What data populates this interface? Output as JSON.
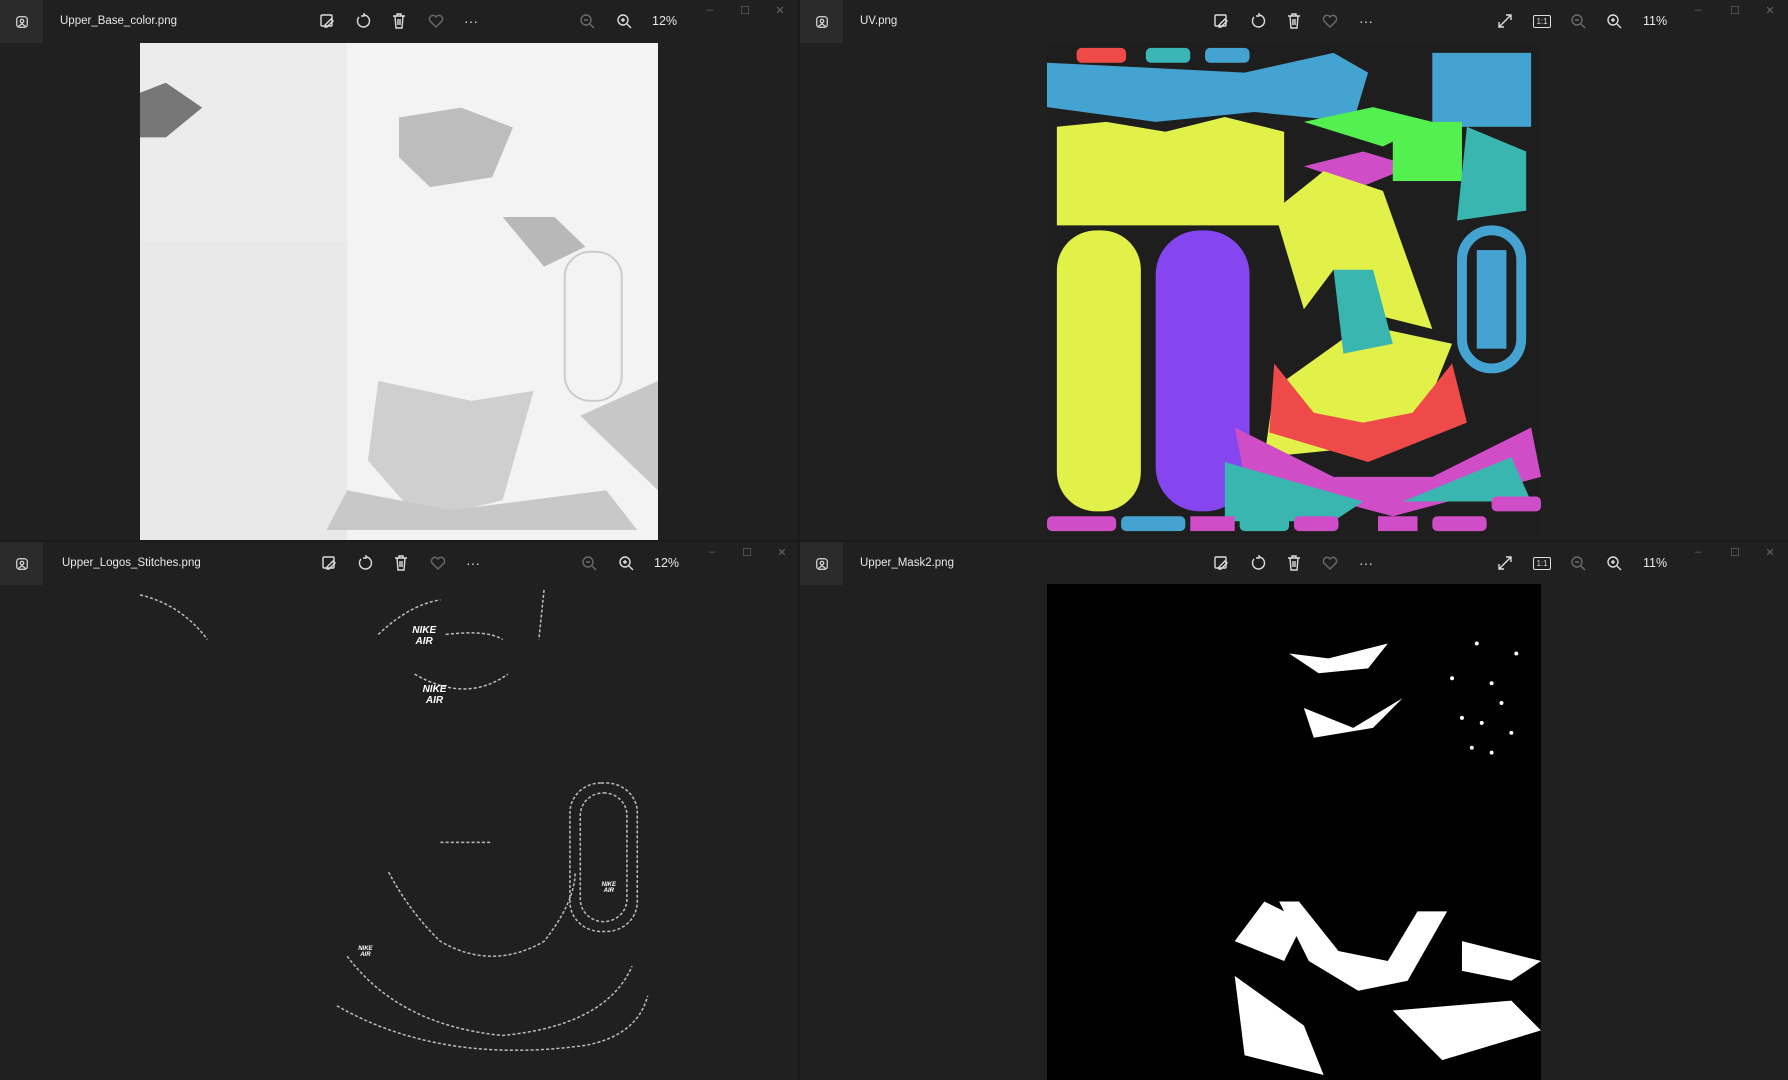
{
  "windows": [
    {
      "filename": "Upper_Base_color.png",
      "zoom": "12%"
    },
    {
      "filename": "UV.png",
      "zoom": "11%"
    },
    {
      "filename": "Upper_Logos_Stitches.png",
      "zoom": "12%"
    },
    {
      "filename": "Upper_Mask2.png",
      "zoom": "11%"
    }
  ],
  "window_controls": {
    "minimize": "–",
    "maximize": "☐",
    "close": "✕"
  },
  "toolbar": {
    "more": "···",
    "actual_size": "1:1"
  },
  "logo_text": [
    "NIKE AIR",
    "NIKE AIR",
    "NIKE AIR",
    "NIKE AIR"
  ],
  "colors": {
    "bg": "#202020",
    "titlebar_btn": "#2b2b2b",
    "text": "#e8e8e8"
  }
}
